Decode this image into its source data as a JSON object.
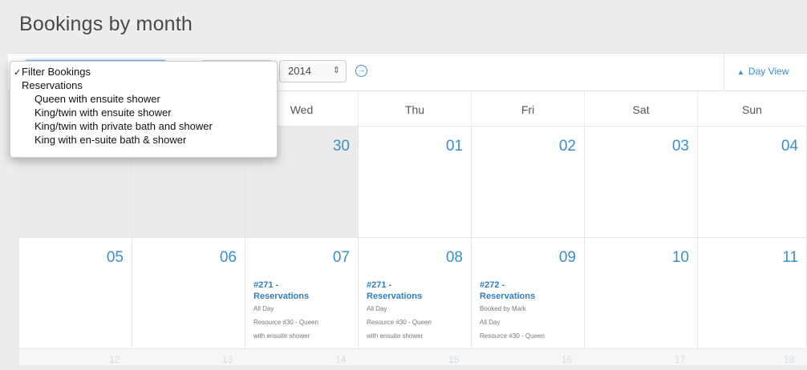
{
  "page": {
    "title": "Bookings by month"
  },
  "toolbar": {
    "year_value": "2014",
    "year_arrows": "⇕",
    "go_icon": "→",
    "day_view_label": "Day View",
    "day_view_icon": "▲"
  },
  "filter_menu": {
    "items": [
      {
        "label": "Filter Bookings",
        "level": 0,
        "checked": true,
        "check_mark": "✓"
      },
      {
        "label": "Reservations",
        "level": 1
      },
      {
        "label": "Queen with ensuite shower",
        "level": 2
      },
      {
        "label": "King/twin with ensuite shower",
        "level": 2
      },
      {
        "label": "King/twin with private bath and shower",
        "level": 2
      },
      {
        "label": "King with en-suite bath & shower",
        "level": 2
      }
    ]
  },
  "calendar": {
    "headers": [
      "",
      "",
      "Wed",
      "Thu",
      "Fri",
      "Sat",
      "Sun"
    ],
    "week1": [
      "",
      "",
      "30",
      "01",
      "02",
      "03",
      "04"
    ],
    "week2": [
      "05",
      "06",
      "07",
      "08",
      "09",
      "10",
      "11"
    ],
    "events": [
      {
        "day": "07",
        "title1": "#271 -",
        "title2": "Reservations",
        "lines": [
          "All Day",
          "Resource #30 - Queen",
          "with ensuite shower"
        ]
      },
      {
        "day": "08",
        "title1": "#271 -",
        "title2": "Reservations",
        "lines": [
          "All Day",
          "Resource #30 - Queen",
          "with ensuite shower"
        ]
      },
      {
        "day": "09",
        "title1": "#272 -",
        "title2": "Reservations",
        "lines": [
          "Booked by Mark",
          "All Day",
          "Resource #30 - Queen"
        ]
      }
    ],
    "week3": [
      "12",
      "13",
      "14",
      "15",
      "16",
      "17",
      "18"
    ]
  },
  "colors": {
    "accent": "#3a8fc9",
    "dim_cell": "#ebebeb"
  }
}
